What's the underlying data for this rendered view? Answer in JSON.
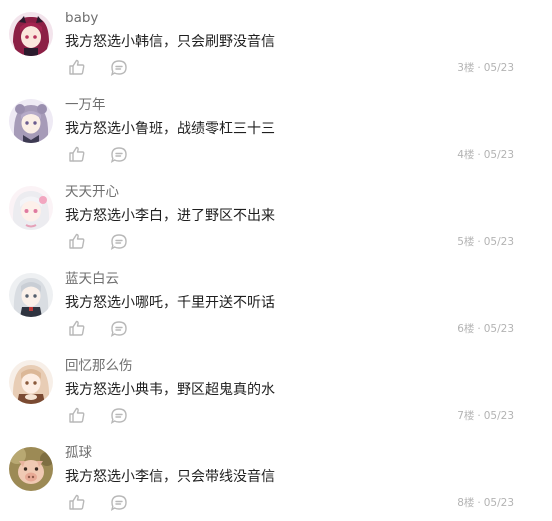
{
  "comments": [
    {
      "username": "baby",
      "text": "我方怒选小韩信，只会刷野没音信",
      "floor": "3楼",
      "date": "05/23"
    },
    {
      "username": "一万年",
      "text": "我方怒选小鲁班，战绩零杠三十三",
      "floor": "4楼",
      "date": "05/23"
    },
    {
      "username": "天天开心",
      "text": "我方怒选小李白，进了野区不出来",
      "floor": "5楼",
      "date": "05/23"
    },
    {
      "username": "蓝天白云",
      "text": "我方怒选小哪吒，千里开送不听话",
      "floor": "6楼",
      "date": "05/23"
    },
    {
      "username": "回忆那么伤",
      "text": "我方怒选小典韦，野区超鬼真的水",
      "floor": "7楼",
      "date": "05/23"
    },
    {
      "username": "孤球",
      "text": "我方怒选小李信，只会带线没音信",
      "floor": "8楼",
      "date": "05/23"
    }
  ],
  "meta_separator": "·",
  "icons": {
    "like": "thumbs-up-icon",
    "reply": "comment-bubble-icon"
  },
  "colors": {
    "username": "#6f6f6f",
    "text": "#1f1f1f",
    "meta": "#b3b3b3",
    "icon": "#b8b8b8"
  }
}
